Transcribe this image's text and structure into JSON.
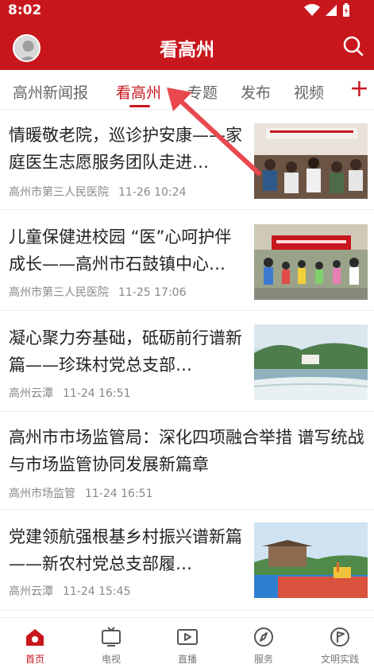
{
  "status": {
    "time": "8:02"
  },
  "header": {
    "title": "看高州"
  },
  "tabs": [
    {
      "label": "高州新闻报"
    },
    {
      "label": "看高州"
    },
    {
      "label": "专题"
    },
    {
      "label": "发布"
    },
    {
      "label": "视频"
    }
  ],
  "articles": [
    {
      "title": "情暖敬老院，巡诊护安康——家庭医生志愿服务团队走进…",
      "source": "高州市第三人民医院",
      "time": "11-26 10:24"
    },
    {
      "title": "儿童保健进校园 “医”心呵护伴成长——高州市石鼓镇中心…",
      "source": "高州市第三人民医院",
      "time": "11-25 17:06"
    },
    {
      "title": "凝心聚力夯基础，砥砺前行谱新篇——珍珠村党总支部…",
      "source": "高州云潭",
      "time": "11-24 16:51"
    },
    {
      "title": "高州市市场监管局：深化四项融合举措 谱写统战与市场监管协同发展新篇章",
      "source": "高州市场监管",
      "time": "11-24 16:51"
    },
    {
      "title": "党建领航强根基乡村振兴谱新篇——新农村党总支部履…",
      "source": "高州云潭",
      "time": "11-24 15:45"
    }
  ],
  "bottom_nav": [
    {
      "label": "首页"
    },
    {
      "label": "电视"
    },
    {
      "label": "直播"
    },
    {
      "label": "服务"
    },
    {
      "label": "文明实践"
    }
  ],
  "colors": {
    "brand": "#c8161d"
  }
}
